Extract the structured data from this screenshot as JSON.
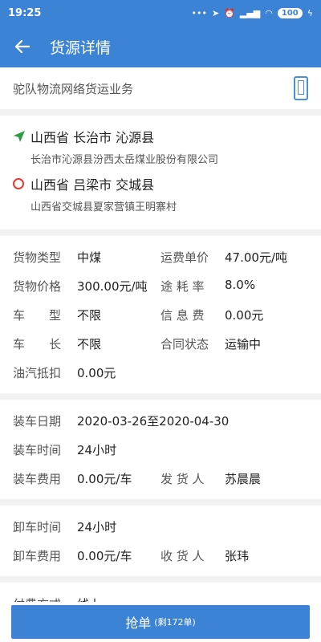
{
  "status_bar": {
    "time": "19:25",
    "battery": "100"
  },
  "header": {
    "title": "货源详情"
  },
  "business": {
    "text": "驼队物流网络货运业务"
  },
  "route": {
    "start": {
      "region": "山西省 长治市 沁源县",
      "address": "长治市沁源县汾西太岳煤业股份有限公司"
    },
    "end": {
      "region": "山西省 吕梁市 交城县",
      "address": "山西省交城县夏家营镇王明寨村"
    }
  },
  "cargo": {
    "type_label": "货物类型",
    "type_value": "中煤",
    "price_label": "运费单价",
    "price_value": "47.00元/吨",
    "goods_price_label": "货物价格",
    "goods_price_value": "300.00元/吨",
    "loss_label": "途 耗 率",
    "loss_value": "8.0%",
    "car_type_label": "车　　型",
    "car_type_value": "不限",
    "info_fee_label": "信 息 费",
    "info_fee_value": "0.00元",
    "car_len_label": "车　　长",
    "car_len_value": "不限",
    "contract_label": "合同状态",
    "contract_value": "运输中",
    "fuel_label": "油汽抵扣",
    "fuel_value": "0.00元"
  },
  "loading": {
    "date_label": "装车日期",
    "date_value": "2020-03-26至2020-04-30",
    "time_label": "装车时间",
    "time_value": "24小时",
    "fee_label": "装车费用",
    "fee_value": "0.00元/车",
    "shipper_label": "发 货 人",
    "shipper_value": "苏晨晨"
  },
  "unloading": {
    "time_label": "卸车时间",
    "time_value": "24小时",
    "fee_label": "卸车费用",
    "fee_value": "0.00元/车",
    "receiver_label": "收 货 人",
    "receiver_value": "张玮"
  },
  "payment": {
    "label": "付费方式",
    "value": "线上"
  },
  "action": {
    "label": "抢单",
    "sub": "(剩172单)"
  }
}
